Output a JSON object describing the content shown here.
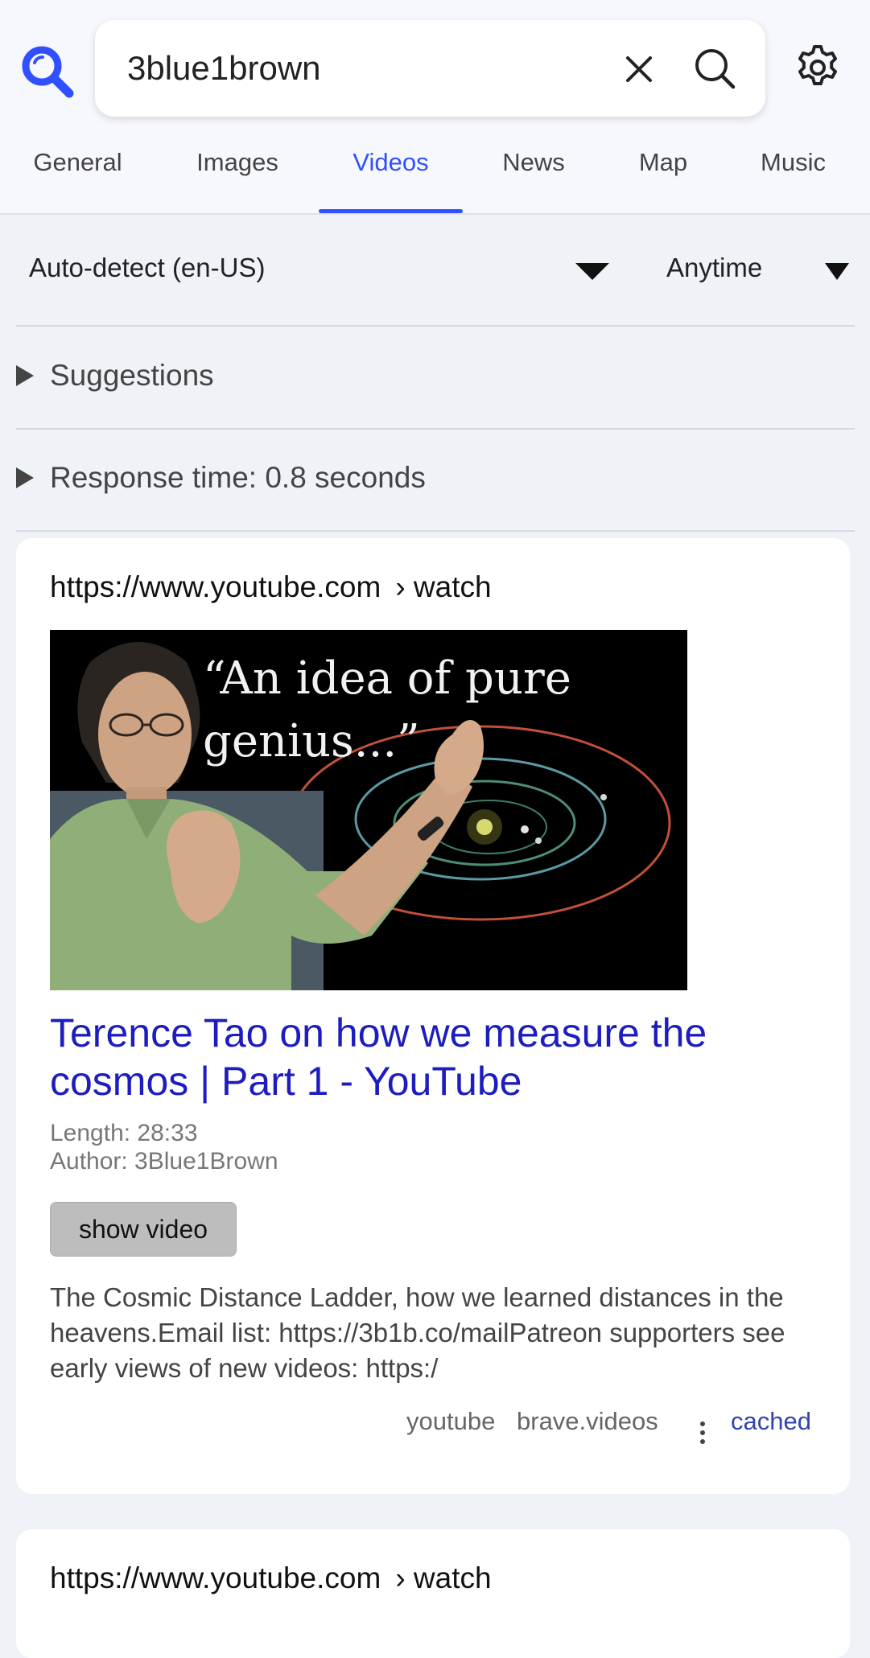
{
  "search": {
    "query": "3blue1brown",
    "accent_color": "#3050ff"
  },
  "tabs": [
    {
      "label": "General"
    },
    {
      "label": "Images"
    },
    {
      "label": "Videos",
      "active": true
    },
    {
      "label": "News"
    },
    {
      "label": "Map"
    },
    {
      "label": "Music"
    }
  ],
  "filters": {
    "language": "Auto-detect (en-US)",
    "time_range": "Anytime"
  },
  "summaries": {
    "suggestions": "Suggestions",
    "response_time": "Response time: 0.8 seconds"
  },
  "results": [
    {
      "url_domain": "https://www.youtube.com",
      "url_path": "› watch",
      "thumbnail_text": "“An idea of pure\ngenius...”",
      "title": "Terence Tao on how we measure the cosmos | Part 1 - YouTube",
      "length": "Length: 28:33",
      "author": "Author: 3Blue1Brown",
      "show_video_label": "show video",
      "description": "The Cosmic Distance Ladder, how we learned distances in the heavens.Email list: https://3b1b.co/mailPatreon supporters see early views of new videos: https:/",
      "engines": [
        "youtube",
        "brave.videos"
      ],
      "cached_label": "cached"
    },
    {
      "url_domain": "https://www.youtube.com",
      "url_path": "› watch"
    }
  ]
}
